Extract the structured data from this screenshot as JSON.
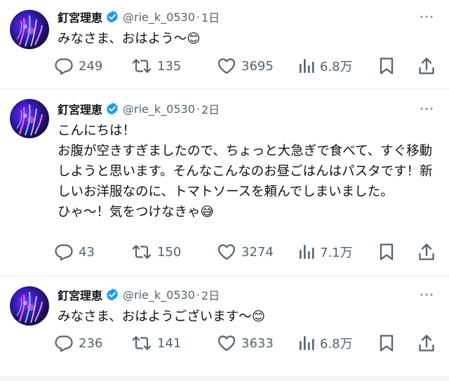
{
  "tweets": [
    {
      "name": "釘宮理恵",
      "handle": "@rie_k_0530",
      "time": "1日",
      "text": "みなさま、おはよう〜😊",
      "reply_count": "249",
      "retweet_count": "135",
      "like_count": "3695",
      "view_count": "6.8万"
    },
    {
      "name": "釘宮理恵",
      "handle": "@rie_k_0530",
      "time": "2日",
      "text": "こんにちは！\nお腹が空きすぎましたので、ちょっと大急ぎで食べて、すぐ移動しようと思います。そんなこんなのお昼ごはんはパスタです！新しいお洋服なのに、トマトソースを頼んでしまいました。\nひゃ〜！気をつけなきゃ😅",
      "reply_count": "43",
      "retweet_count": "150",
      "like_count": "3274",
      "view_count": "7.1万"
    },
    {
      "name": "釘宮理恵",
      "handle": "@rie_k_0530",
      "time": "2日",
      "text": "みなさま、おはようございます〜😊",
      "reply_count": "236",
      "retweet_count": "141",
      "like_count": "3633",
      "view_count": "6.8万"
    }
  ],
  "colors": {
    "text": "#0f1419",
    "secondary": "#536471",
    "verified": "#1d9bf0",
    "divider": "#e6e8ea"
  },
  "icons": [
    "avatar",
    "verified-badge-icon",
    "more-icon",
    "reply-icon",
    "retweet-icon",
    "like-icon",
    "views-icon",
    "bookmark-icon",
    "share-icon"
  ]
}
